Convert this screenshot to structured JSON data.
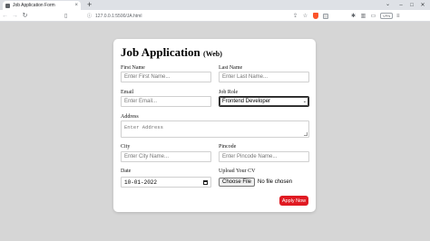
{
  "browser": {
    "tab_title": "Job Application Form",
    "tab_close": "×",
    "new_tab": "+",
    "url": "127.0.0.1:5500/JA.html",
    "vpn_label": "VPN",
    "window_buttons": [
      "–",
      "□",
      "✕"
    ]
  },
  "form": {
    "title": "Job Application",
    "title_suffix": "(Web)",
    "first_name": {
      "label": "First Name",
      "placeholder": "Enter First Name..."
    },
    "last_name": {
      "label": "Last Name",
      "placeholder": "Enter Last Name..."
    },
    "email": {
      "label": "Email",
      "placeholder": "Enter Email..."
    },
    "job_role": {
      "label": "Job Role",
      "value": "Frontend Developer"
    },
    "address": {
      "label": "Address",
      "placeholder": "Enter Address"
    },
    "city": {
      "label": "City",
      "placeholder": "Enter City Name..."
    },
    "pincode": {
      "label": "Pincode",
      "placeholder": "Enter Pincode Name..."
    },
    "date": {
      "label": "Date",
      "value": "10-01-2022"
    },
    "cv": {
      "label": "Upload Your CV",
      "button": "Choose File",
      "status": "No file chosen"
    },
    "submit_label": "Apply Now"
  },
  "colors": {
    "accent": "#e01a22",
    "page_bg": "#d6d6d6"
  }
}
